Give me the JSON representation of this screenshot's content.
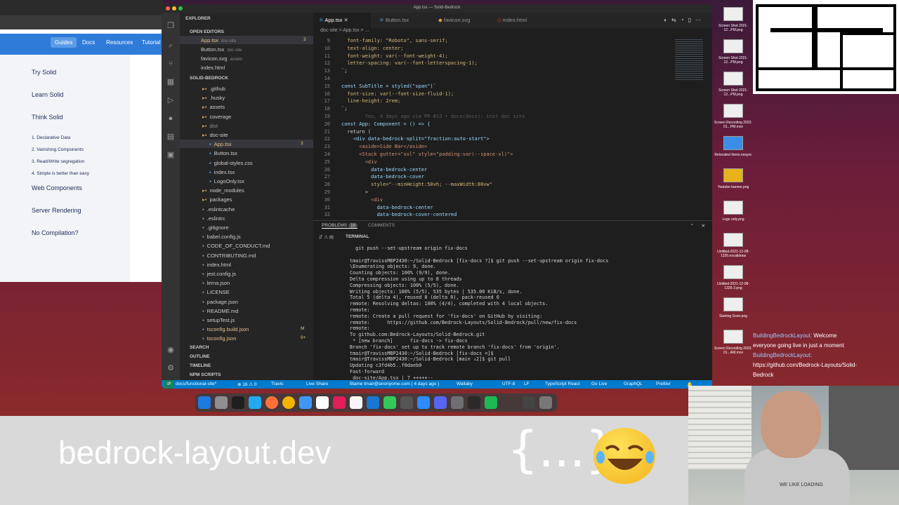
{
  "browser": {
    "nav": [
      "Guides",
      "Docs",
      "Resources",
      "Tutorial"
    ],
    "sidebar": [
      "Try Solid",
      "Learn Solid",
      "Think Solid",
      "Web Components",
      "Server Rendering",
      "No Compilation?"
    ],
    "think_items": [
      "1. Declarative Data",
      "2. Vanishing Components",
      "3. Read/Write segregation",
      "4. Simple is better than easy"
    ]
  },
  "vscode": {
    "title": "App.tsx — Solid-Bedrock",
    "explorer_label": "EXPLORER",
    "open_editors_label": "OPEN EDITORS",
    "open_editors": [
      {
        "name": "App.tsx",
        "hint": "doc-site",
        "badge": "3"
      },
      {
        "name": "Button.tsx",
        "hint": "doc-site",
        "badge": ""
      },
      {
        "name": "favicon.svg",
        "hint": "assets",
        "badge": ""
      },
      {
        "name": "index.html",
        "hint": "",
        "badge": ""
      }
    ],
    "project_label": "SOLID-BEDROCK",
    "tree": [
      {
        "name": ".github",
        "indent": 1,
        "folder": true
      },
      {
        "name": ".husky",
        "indent": 1,
        "folder": true
      },
      {
        "name": "assets",
        "indent": 1,
        "folder": true
      },
      {
        "name": "coverage",
        "indent": 1,
        "folder": true
      },
      {
        "name": "dist",
        "indent": 1,
        "folder": true
      },
      {
        "name": "doc-site",
        "indent": 1,
        "folder": true
      },
      {
        "name": "App.tsx",
        "indent": 2,
        "folder": false
      },
      {
        "name": "Button.tsx",
        "indent": 2,
        "folder": false
      },
      {
        "name": "global-styles.css",
        "indent": 2,
        "folder": false
      },
      {
        "name": "index.tsx",
        "indent": 2,
        "folder": false
      },
      {
        "name": "LogoOnly.tsx",
        "indent": 2,
        "folder": false
      },
      {
        "name": "node_modules",
        "indent": 1,
        "folder": true
      },
      {
        "name": "packages",
        "indent": 1,
        "folder": true
      },
      {
        "name": ".eslintcache",
        "indent": 1,
        "folder": false
      },
      {
        "name": ".eslintrc",
        "indent": 1,
        "folder": false
      },
      {
        "name": ".gitignore",
        "indent": 1,
        "folder": false
      },
      {
        "name": "babel.config.js",
        "indent": 1,
        "folder": false
      },
      {
        "name": "CODE_OF_CONDUCT.md",
        "indent": 1,
        "folder": false
      },
      {
        "name": "CONTRIBUTING.md",
        "indent": 1,
        "folder": false
      },
      {
        "name": "index.html",
        "indent": 1,
        "folder": false
      },
      {
        "name": "jest.config.js",
        "indent": 1,
        "folder": false
      },
      {
        "name": "lerna.json",
        "indent": 1,
        "folder": false
      },
      {
        "name": "LICENSE",
        "indent": 1,
        "folder": false
      },
      {
        "name": "package.json",
        "indent": 1,
        "folder": false
      },
      {
        "name": "README.md",
        "indent": 1,
        "folder": false
      },
      {
        "name": "setupTest.js",
        "indent": 1,
        "folder": false
      },
      {
        "name": "tsconfig.build.json",
        "indent": 1,
        "folder": false
      },
      {
        "name": "tsconfig.json",
        "indent": 1,
        "folder": false
      }
    ],
    "tree_badges": {
      "app": "3",
      "build": "M",
      "ts": "9+"
    },
    "bottom_sections": [
      "SEARCH",
      "OUTLINE",
      "TIMELINE",
      "NPM SCRIPTS"
    ],
    "tabs": [
      "App.tsx",
      "Button.tsx",
      "favicon.svg",
      "index.html"
    ],
    "breadcrumb": "doc-site > App.tsx > ...",
    "code": [
      {
        "n": "9",
        "t": "  font-family: \"Roboto\", sans-serif;"
      },
      {
        "n": "10",
        "t": "  text-align: center;"
      },
      {
        "n": "11",
        "t": "  font-weight: var(--font-weight-4);"
      },
      {
        "n": "12",
        "t": "  letter-spacing: var(--font-letterspacing-1);"
      },
      {
        "n": "13",
        "t": "`;"
      },
      {
        "n": "14",
        "t": ""
      },
      {
        "n": "15",
        "t": "const SubTitle = styled(\"span\")`"
      },
      {
        "n": "16",
        "t": "  font-size: var(--font-size-fluid-1);"
      },
      {
        "n": "17",
        "t": "  line-height: 2rem;"
      },
      {
        "n": "18",
        "t": "`;"
      },
      {
        "n": "19",
        "t": "        You, 4 days ago via PR #13 • docs(docs): init doc site"
      },
      {
        "n": "20",
        "t": "const App: Component = () => {"
      },
      {
        "n": "21",
        "t": "  return ("
      },
      {
        "n": "22",
        "t": "    <div data-bedrock-split=\"fraction:auto-start\">"
      },
      {
        "n": "23",
        "t": "      <aside>Side Bar</aside>"
      },
      {
        "n": "24",
        "t": "      <Stack gutter=\"xxl\" style=\"padding:var(--space-xl)\">"
      },
      {
        "n": "25",
        "t": "        <div"
      },
      {
        "n": "26",
        "t": "          data-bedrock-center"
      },
      {
        "n": "27",
        "t": "          data-bedrock-cover"
      },
      {
        "n": "28",
        "t": "          style=\"--minHeight:50vh; --maxWidth:80vw\""
      },
      {
        "n": "29",
        "t": "        >"
      },
      {
        "n": "30",
        "t": "          <div"
      },
      {
        "n": "31",
        "t": "            data-bedrock-center"
      },
      {
        "n": "32",
        "t": "            data-bedrock-cover-centered"
      }
    ],
    "panel_tabs": [
      "PROBLEMS",
      "COMMENTS"
    ],
    "problems_count": "16",
    "terminal_label": "TERMINAL",
    "terminal": [
      "  git push --set-upstream origin fix-docs",
      "",
      "tmair@TravissMBP2430:~/Solid-Bedrock [fix-docs ?]$ git push --set-upstream origin fix-docs",
      "\\Enumerating objects: 9, done.",
      "Counting objects: 100% (9/9), done.",
      "Delta compression using up to 8 threads",
      "Compressing objects: 100% (5/5), done.",
      "Writing objects: 100% (5/5), 535 bytes | 535.00 KiB/s, done.",
      "Total 5 (delta 4), reused 0 (delta 0), pack-reused 0",
      "remote: Resolving deltas: 100% (4/4), completed with 4 local objects.",
      "remote:",
      "remote: Create a pull request for 'fix-docs' on GitHub by visiting:",
      "remote:      https://github.com/Bedrock-Layouts/Solid-Bedrock/pull/new/fix-docs",
      "remote:",
      "To github.com:Bedrock-Layouts/Solid-Bedrock.git",
      " * [new branch]      fix-docs -> fix-docs",
      "Branch 'fix-docs' set up to track remote branch 'fix-docs' from 'origin'.",
      "tmair@TravissMBP2430:~/Solid-Bedrock [fix-docs =]$",
      "tmair@TravissMBP2430:~/Solid-Bedrock [main ↓2]$ git pull",
      "Updating c3fd4b5..f0daeb0",
      "Fast-forward",
      " doc-site/App.tsx | 7 +++++--"
    ],
    "status": {
      "branch": "docs/functional-site*",
      "problems": "⊗ 16 ⚠ 0",
      "travis": "Travis",
      "liveshare": "Live Share",
      "blame": "Blame tmair@anonyome.com ( 4 days ago )",
      "wallaby": "Wallaby",
      "encoding": "UTF-8",
      "eol": "LF",
      "lang": "TypeScript React",
      "golive": "Go Live",
      "graphql": "GraphQL",
      "prettier": "Prettier"
    }
  },
  "desktop_files": [
    "Screen Shot 2021-12...PM.png",
    "Screen Shot 2021-12...PM.png",
    "Screen Shot 2021-12...PM.png",
    "Screen Recording 2022-01...PM.mov",
    "Relocated Items.nosync",
    "Youtube banner.png",
    "Logo only.png",
    "Untitled-2021-12-08-1326.excalidraw",
    "Untitled-2021-12-08-1326-2.png",
    "Starting Soon.png",
    "Screen Recording 2022-01...AM.mov"
  ],
  "chat": [
    {
      "user": "BuildingBedrockLayout:",
      "msg": " Welcome"
    },
    {
      "user": "",
      "msg": "everyone going live in just a moment"
    },
    {
      "user": "BuildingBedrockLayout:",
      "msg": ""
    },
    {
      "user": "",
      "msg": "https://github.com/Bedrock-Layouts/Solid-"
    },
    {
      "user": "",
      "msg": "Bedrock"
    }
  ],
  "banner": {
    "site": "bedrock-layout.dev",
    "logo_text": "{...}"
  },
  "webcam_shirt": "WE LIKE LOADING"
}
